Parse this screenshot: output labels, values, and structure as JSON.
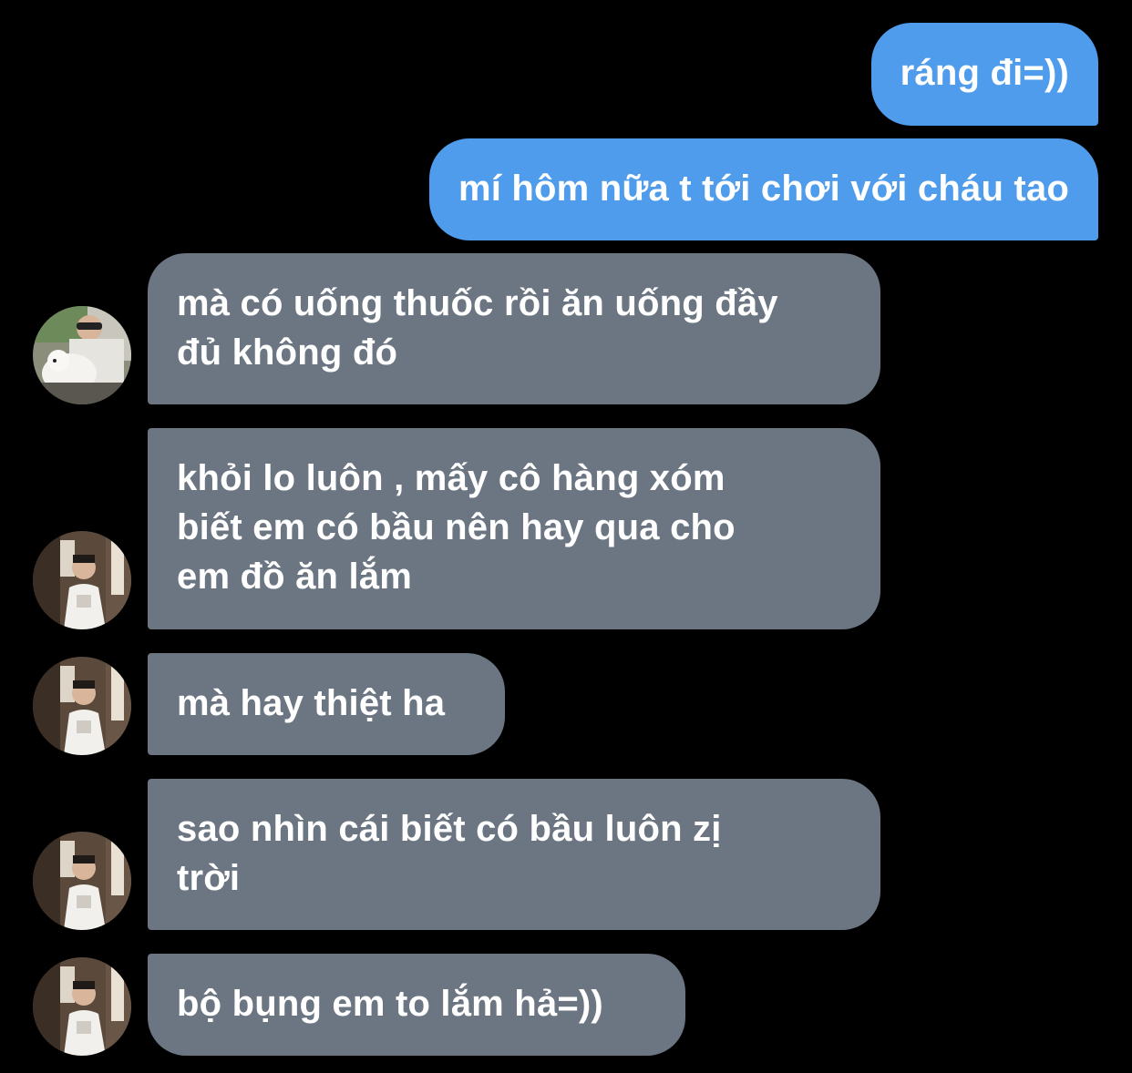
{
  "messages": [
    {
      "id": "m1",
      "direction": "sent",
      "text": "ráng đi=))"
    },
    {
      "id": "m2",
      "direction": "sent",
      "text": "mí hôm nữa t tới chơi với cháu tao"
    },
    {
      "id": "m3",
      "direction": "received",
      "lines": [
        "mà có uống thuốc rồi ăn uống đầy",
        "đủ không đó"
      ]
    },
    {
      "id": "m4",
      "direction": "received",
      "lines": [
        "khỏi lo luôn , mấy cô hàng xóm",
        "biết em có bầu nên hay qua cho",
        "em đồ ăn lắm"
      ]
    },
    {
      "id": "m5",
      "direction": "received",
      "text": "mà hay thiệt ha"
    },
    {
      "id": "m6",
      "direction": "received",
      "lines": [
        "sao nhìn cái biết có bầu luôn zị",
        "trời"
      ]
    },
    {
      "id": "m7",
      "direction": "received",
      "text": "bộ bụng em to lắm hả=))"
    }
  ],
  "colors": {
    "background": "#000000",
    "sent_bubble": "#4e9ceb",
    "received_bubble": "#6b7682",
    "text": "#ffffff"
  },
  "avatars": [
    {
      "for": "m3",
      "icon": "avatar-photo-person-with-white-dog"
    },
    {
      "for": "m4",
      "icon": "avatar-photo-person-in-room"
    },
    {
      "for": "m5",
      "icon": "avatar-photo-person-in-room"
    },
    {
      "for": "m6",
      "icon": "avatar-photo-person-in-room"
    },
    {
      "for": "m7",
      "icon": "avatar-photo-person-in-room"
    }
  ]
}
